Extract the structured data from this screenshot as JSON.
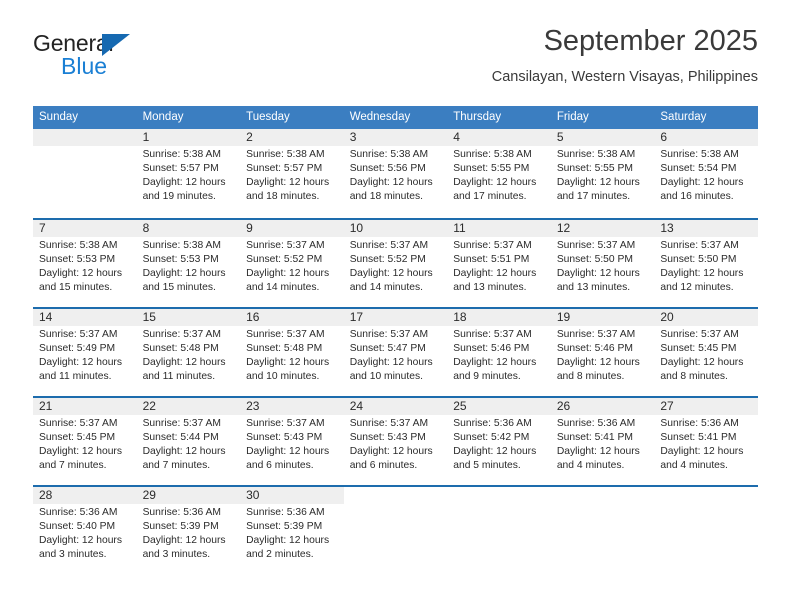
{
  "brand": {
    "line1": "General",
    "line2": "Blue",
    "triangle_icon": "triangle-icon",
    "accent_blue": "#1a7fd4",
    "triangle_blue": "#1669b1"
  },
  "header": {
    "month_title": "September 2025",
    "location": "Cansilayan, Western Visayas, Philippines"
  },
  "calendar": {
    "header_bg": "#3b7ec1",
    "separator_color": "#1d6cad",
    "daynum_band_bg": "#efefef",
    "weekdays": [
      "Sunday",
      "Monday",
      "Tuesday",
      "Wednesday",
      "Thursday",
      "Friday",
      "Saturday"
    ],
    "weeks": [
      [
        {
          "day": "",
          "sunrise": "",
          "sunset": "",
          "daylight_1": "",
          "daylight_2": ""
        },
        {
          "day": "1",
          "sunrise": "Sunrise: 5:38 AM",
          "sunset": "Sunset: 5:57 PM",
          "daylight_1": "Daylight: 12 hours",
          "daylight_2": "and 19 minutes."
        },
        {
          "day": "2",
          "sunrise": "Sunrise: 5:38 AM",
          "sunset": "Sunset: 5:57 PM",
          "daylight_1": "Daylight: 12 hours",
          "daylight_2": "and 18 minutes."
        },
        {
          "day": "3",
          "sunrise": "Sunrise: 5:38 AM",
          "sunset": "Sunset: 5:56 PM",
          "daylight_1": "Daylight: 12 hours",
          "daylight_2": "and 18 minutes."
        },
        {
          "day": "4",
          "sunrise": "Sunrise: 5:38 AM",
          "sunset": "Sunset: 5:55 PM",
          "daylight_1": "Daylight: 12 hours",
          "daylight_2": "and 17 minutes."
        },
        {
          "day": "5",
          "sunrise": "Sunrise: 5:38 AM",
          "sunset": "Sunset: 5:55 PM",
          "daylight_1": "Daylight: 12 hours",
          "daylight_2": "and 17 minutes."
        },
        {
          "day": "6",
          "sunrise": "Sunrise: 5:38 AM",
          "sunset": "Sunset: 5:54 PM",
          "daylight_1": "Daylight: 12 hours",
          "daylight_2": "and 16 minutes."
        }
      ],
      [
        {
          "day": "7",
          "sunrise": "Sunrise: 5:38 AM",
          "sunset": "Sunset: 5:53 PM",
          "daylight_1": "Daylight: 12 hours",
          "daylight_2": "and 15 minutes."
        },
        {
          "day": "8",
          "sunrise": "Sunrise: 5:38 AM",
          "sunset": "Sunset: 5:53 PM",
          "daylight_1": "Daylight: 12 hours",
          "daylight_2": "and 15 minutes."
        },
        {
          "day": "9",
          "sunrise": "Sunrise: 5:37 AM",
          "sunset": "Sunset: 5:52 PM",
          "daylight_1": "Daylight: 12 hours",
          "daylight_2": "and 14 minutes."
        },
        {
          "day": "10",
          "sunrise": "Sunrise: 5:37 AM",
          "sunset": "Sunset: 5:52 PM",
          "daylight_1": "Daylight: 12 hours",
          "daylight_2": "and 14 minutes."
        },
        {
          "day": "11",
          "sunrise": "Sunrise: 5:37 AM",
          "sunset": "Sunset: 5:51 PM",
          "daylight_1": "Daylight: 12 hours",
          "daylight_2": "and 13 minutes."
        },
        {
          "day": "12",
          "sunrise": "Sunrise: 5:37 AM",
          "sunset": "Sunset: 5:50 PM",
          "daylight_1": "Daylight: 12 hours",
          "daylight_2": "and 13 minutes."
        },
        {
          "day": "13",
          "sunrise": "Sunrise: 5:37 AM",
          "sunset": "Sunset: 5:50 PM",
          "daylight_1": "Daylight: 12 hours",
          "daylight_2": "and 12 minutes."
        }
      ],
      [
        {
          "day": "14",
          "sunrise": "Sunrise: 5:37 AM",
          "sunset": "Sunset: 5:49 PM",
          "daylight_1": "Daylight: 12 hours",
          "daylight_2": "and 11 minutes."
        },
        {
          "day": "15",
          "sunrise": "Sunrise: 5:37 AM",
          "sunset": "Sunset: 5:48 PM",
          "daylight_1": "Daylight: 12 hours",
          "daylight_2": "and 11 minutes."
        },
        {
          "day": "16",
          "sunrise": "Sunrise: 5:37 AM",
          "sunset": "Sunset: 5:48 PM",
          "daylight_1": "Daylight: 12 hours",
          "daylight_2": "and 10 minutes."
        },
        {
          "day": "17",
          "sunrise": "Sunrise: 5:37 AM",
          "sunset": "Sunset: 5:47 PM",
          "daylight_1": "Daylight: 12 hours",
          "daylight_2": "and 10 minutes."
        },
        {
          "day": "18",
          "sunrise": "Sunrise: 5:37 AM",
          "sunset": "Sunset: 5:46 PM",
          "daylight_1": "Daylight: 12 hours",
          "daylight_2": "and 9 minutes."
        },
        {
          "day": "19",
          "sunrise": "Sunrise: 5:37 AM",
          "sunset": "Sunset: 5:46 PM",
          "daylight_1": "Daylight: 12 hours",
          "daylight_2": "and 8 minutes."
        },
        {
          "day": "20",
          "sunrise": "Sunrise: 5:37 AM",
          "sunset": "Sunset: 5:45 PM",
          "daylight_1": "Daylight: 12 hours",
          "daylight_2": "and 8 minutes."
        }
      ],
      [
        {
          "day": "21",
          "sunrise": "Sunrise: 5:37 AM",
          "sunset": "Sunset: 5:45 PM",
          "daylight_1": "Daylight: 12 hours",
          "daylight_2": "and 7 minutes."
        },
        {
          "day": "22",
          "sunrise": "Sunrise: 5:37 AM",
          "sunset": "Sunset: 5:44 PM",
          "daylight_1": "Daylight: 12 hours",
          "daylight_2": "and 7 minutes."
        },
        {
          "day": "23",
          "sunrise": "Sunrise: 5:37 AM",
          "sunset": "Sunset: 5:43 PM",
          "daylight_1": "Daylight: 12 hours",
          "daylight_2": "and 6 minutes."
        },
        {
          "day": "24",
          "sunrise": "Sunrise: 5:37 AM",
          "sunset": "Sunset: 5:43 PM",
          "daylight_1": "Daylight: 12 hours",
          "daylight_2": "and 6 minutes."
        },
        {
          "day": "25",
          "sunrise": "Sunrise: 5:36 AM",
          "sunset": "Sunset: 5:42 PM",
          "daylight_1": "Daylight: 12 hours",
          "daylight_2": "and 5 minutes."
        },
        {
          "day": "26",
          "sunrise": "Sunrise: 5:36 AM",
          "sunset": "Sunset: 5:41 PM",
          "daylight_1": "Daylight: 12 hours",
          "daylight_2": "and 4 minutes."
        },
        {
          "day": "27",
          "sunrise": "Sunrise: 5:36 AM",
          "sunset": "Sunset: 5:41 PM",
          "daylight_1": "Daylight: 12 hours",
          "daylight_2": "and 4 minutes."
        }
      ],
      [
        {
          "day": "28",
          "sunrise": "Sunrise: 5:36 AM",
          "sunset": "Sunset: 5:40 PM",
          "daylight_1": "Daylight: 12 hours",
          "daylight_2": "and 3 minutes."
        },
        {
          "day": "29",
          "sunrise": "Sunrise: 5:36 AM",
          "sunset": "Sunset: 5:39 PM",
          "daylight_1": "Daylight: 12 hours",
          "daylight_2": "and 3 minutes."
        },
        {
          "day": "30",
          "sunrise": "Sunrise: 5:36 AM",
          "sunset": "Sunset: 5:39 PM",
          "daylight_1": "Daylight: 12 hours",
          "daylight_2": "and 2 minutes."
        },
        {
          "day": "",
          "sunrise": "",
          "sunset": "",
          "daylight_1": "",
          "daylight_2": ""
        },
        {
          "day": "",
          "sunrise": "",
          "sunset": "",
          "daylight_1": "",
          "daylight_2": ""
        },
        {
          "day": "",
          "sunrise": "",
          "sunset": "",
          "daylight_1": "",
          "daylight_2": ""
        },
        {
          "day": "",
          "sunrise": "",
          "sunset": "",
          "daylight_1": "",
          "daylight_2": ""
        }
      ]
    ]
  }
}
